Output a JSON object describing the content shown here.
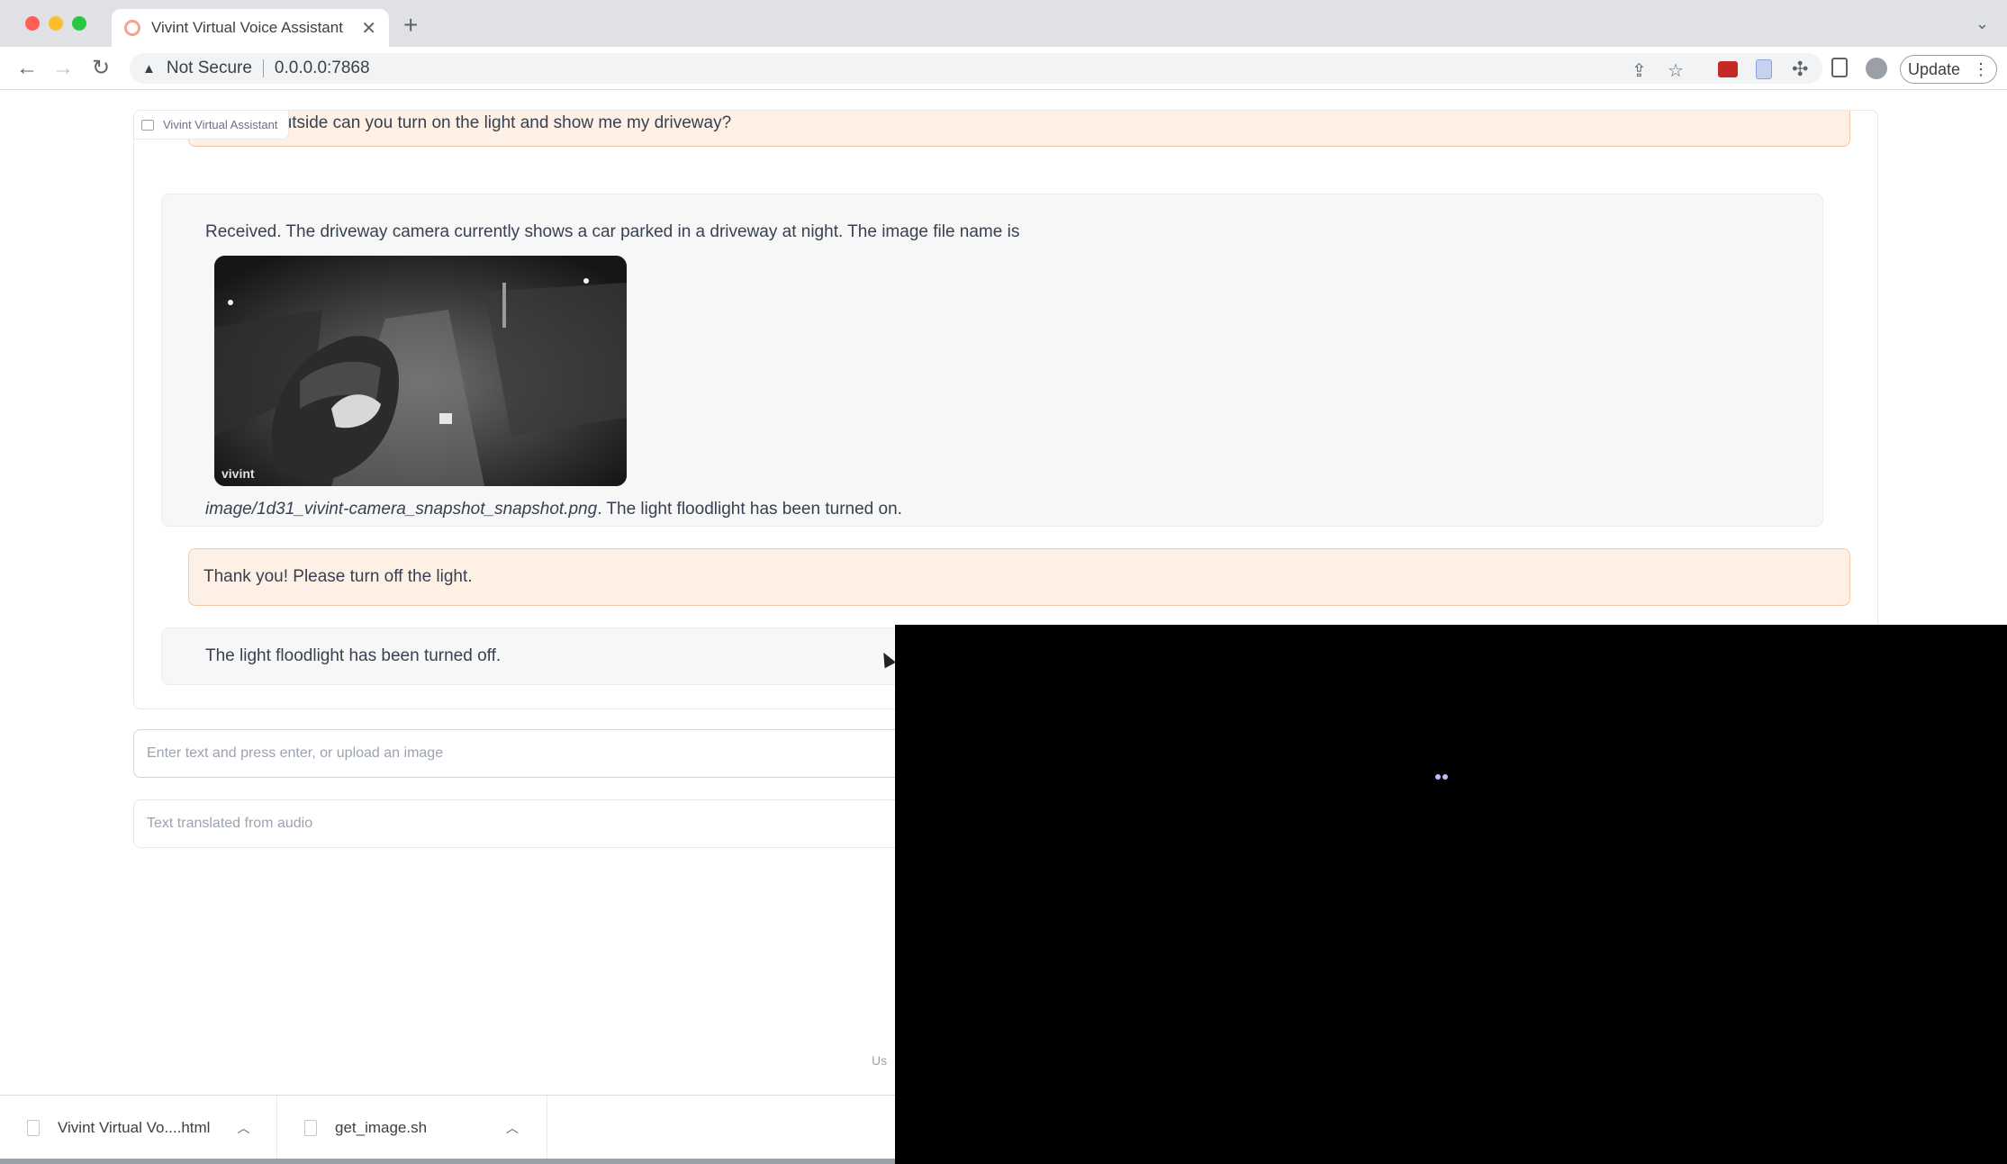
{
  "browser": {
    "tab_title": "Vivint Virtual Voice Assistant",
    "new_tab_icon": "plus-icon",
    "security_label": "Not Secure",
    "url": "0.0.0.0:7868",
    "update_label": "Update"
  },
  "chat": {
    "label": "Vivint Virtual Assistant",
    "messages": [
      {
        "role": "user",
        "text": "It is dark outside can you turn on the light and show me my driveway?"
      },
      {
        "role": "bot",
        "text_before": "Received. The driveway camera currently shows a car parked in a driveway at night. The image file name is",
        "image_watermark": "vivint",
        "filename": "image/1d31_vivint-camera_snapshot_snapshot.png",
        "text_after": ". The light floodlight has been turned on."
      },
      {
        "role": "user",
        "text": "Thank you! Please turn off the light."
      },
      {
        "role": "bot",
        "text": "The light floodlight has been turned off."
      }
    ]
  },
  "inputs": {
    "text_placeholder": "Enter text and press enter, or upload an image",
    "audio_placeholder": "Text translated from audio"
  },
  "footer": {
    "fragment": "Us"
  },
  "downloads": [
    {
      "name": "Vivint Virtual Vo....html"
    },
    {
      "name": "get_image.sh"
    }
  ],
  "colors": {
    "user_bubble": "#fff0e6",
    "user_border": "#f5c6a5",
    "bot_bubble": "#f7f7f8",
    "overlay": "#000000"
  }
}
